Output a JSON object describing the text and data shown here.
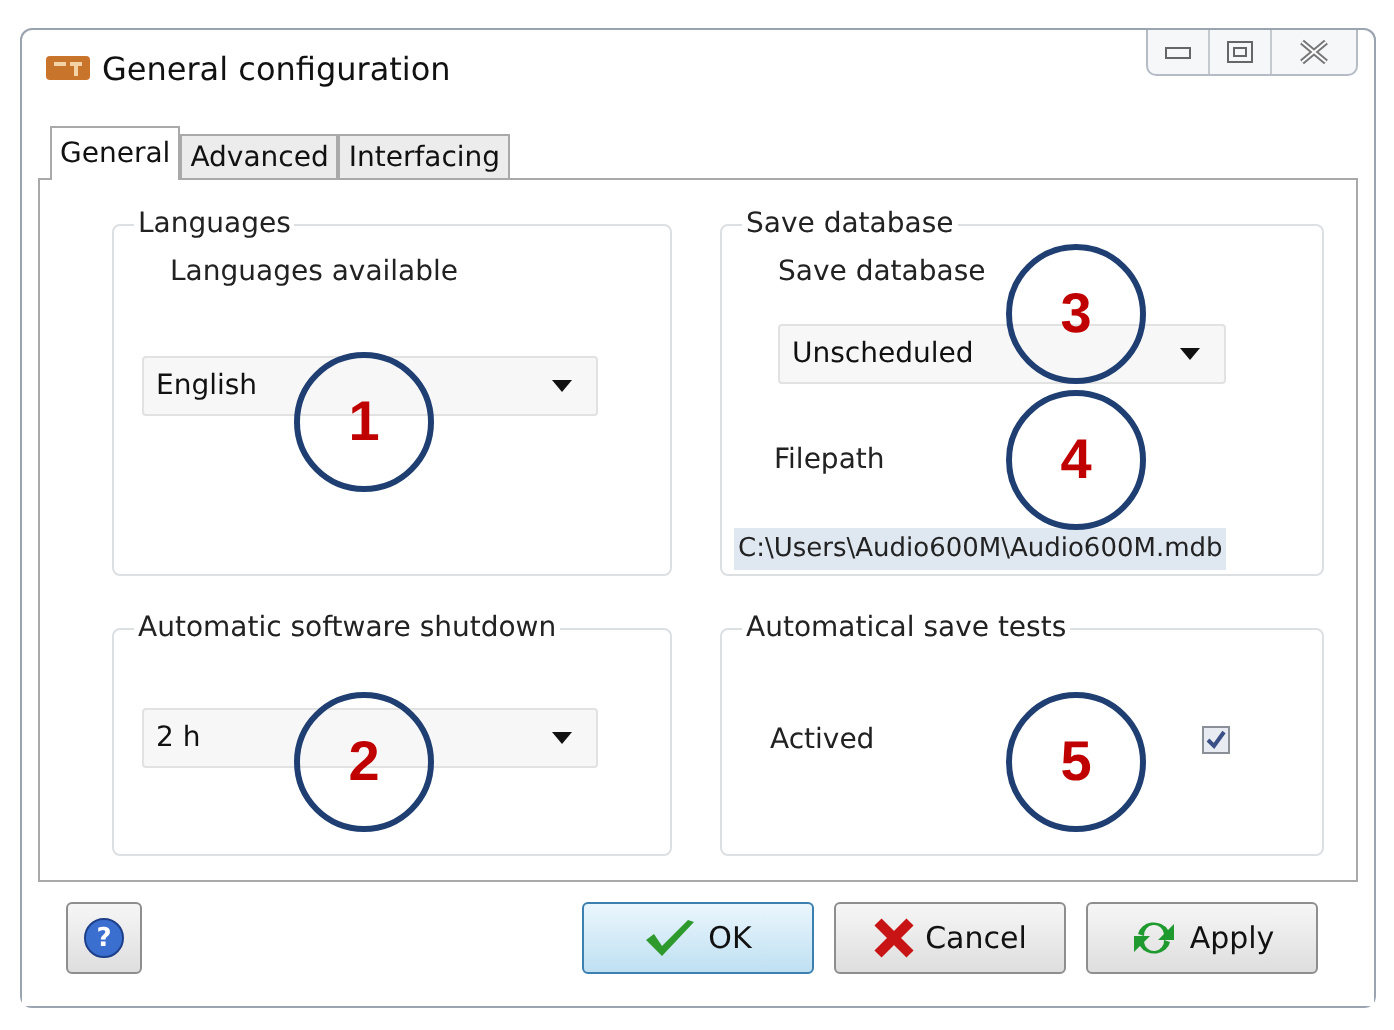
{
  "window": {
    "title": "General configuration"
  },
  "tabs": [
    {
      "label": "General",
      "selected": true
    },
    {
      "label": "Advanced",
      "selected": false
    },
    {
      "label": "Interfacing",
      "selected": false
    }
  ],
  "languages": {
    "title": "Languages",
    "label": "Languages available",
    "value": "English"
  },
  "save_database": {
    "title": "Save database",
    "label": "Save database",
    "value": "Unscheduled",
    "filepath_label": "Filepath",
    "filepath": "C:\\Users\\Audio600M\\Audio600M.mdb"
  },
  "shutdown": {
    "title": "Automatic software shutdown",
    "value": "2 h"
  },
  "save_tests": {
    "title": "Automatical save tests",
    "label": "Actived",
    "checked": true
  },
  "buttons": [
    {
      "kind": "help",
      "label": "?"
    },
    {
      "kind": "ok",
      "label": "OK"
    },
    {
      "kind": "cancel",
      "label": "Cancel"
    },
    {
      "kind": "apply",
      "label": "Apply"
    }
  ],
  "callouts": [
    "1",
    "2",
    "3",
    "4",
    "5"
  ]
}
